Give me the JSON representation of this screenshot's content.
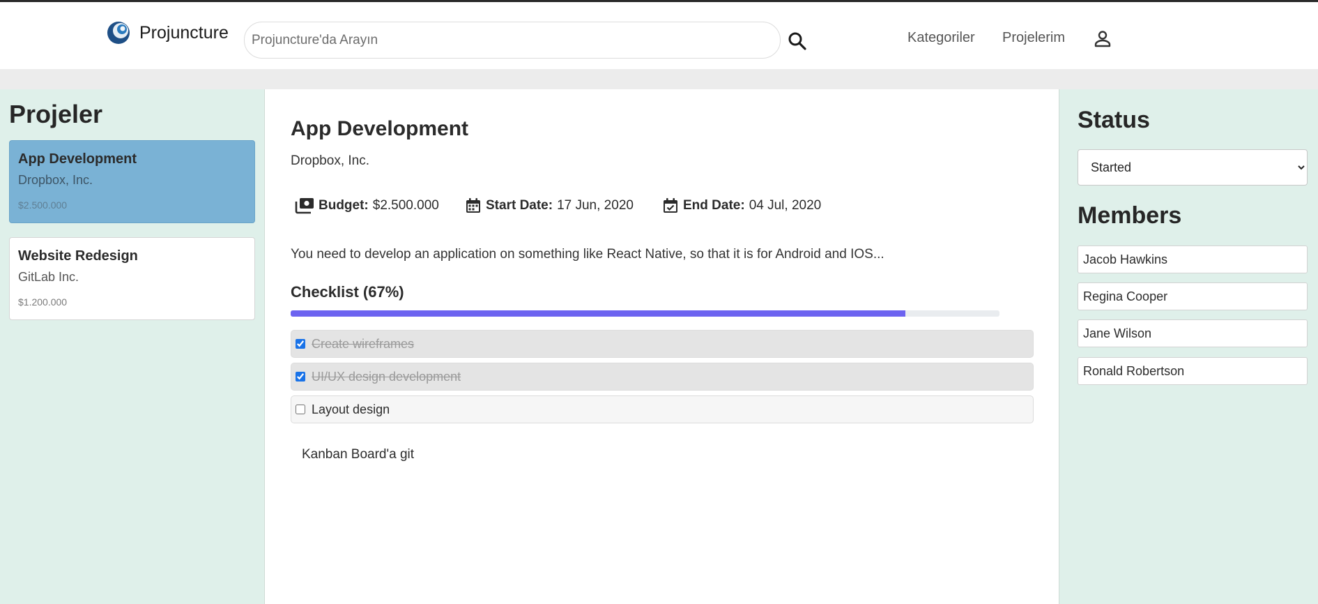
{
  "brand": {
    "name": "Projuncture"
  },
  "search": {
    "placeholder": "Projuncture'da Arayın"
  },
  "nav": {
    "categories": "Kategoriler",
    "my_projects": "Projelerim"
  },
  "sidebar": {
    "title": "Projeler",
    "projects": [
      {
        "title": "App Development",
        "company": "Dropbox, Inc.",
        "budget": "$2.500.000",
        "active": true
      },
      {
        "title": "Website Redesign",
        "company": "GitLab Inc.",
        "budget": "$1.200.000",
        "active": false
      }
    ]
  },
  "project": {
    "title": "App Development",
    "company": "Dropbox, Inc.",
    "budget_label": "Budget:",
    "budget_value": "$2.500.000",
    "start_label": "Start Date:",
    "start_value": "17 Jun, 2020",
    "end_label": "End Date:",
    "end_value": "04 Jul, 2020",
    "description": "You need to develop an application on something like React Native, so that it is for Android and IOS...",
    "checklist_title": "Checklist (67%)",
    "progress_percent": 67,
    "checklist": [
      {
        "label": "Create wireframes",
        "checked": true
      },
      {
        "label": "UI/UX design development",
        "checked": true
      },
      {
        "label": "Layout design",
        "checked": false
      }
    ],
    "kanban_link": "Kanban Board'a git"
  },
  "right": {
    "status_title": "Status",
    "status_value": "Started",
    "members_title": "Members",
    "members": [
      "Jacob Hawkins",
      "Regina Cooper",
      "Jane Wilson",
      "Ronald Robertson"
    ]
  },
  "colors": {
    "sidebar_bg": "#dff0ea",
    "active_card": "#7ab2d5",
    "progress": "#6c63f0"
  }
}
